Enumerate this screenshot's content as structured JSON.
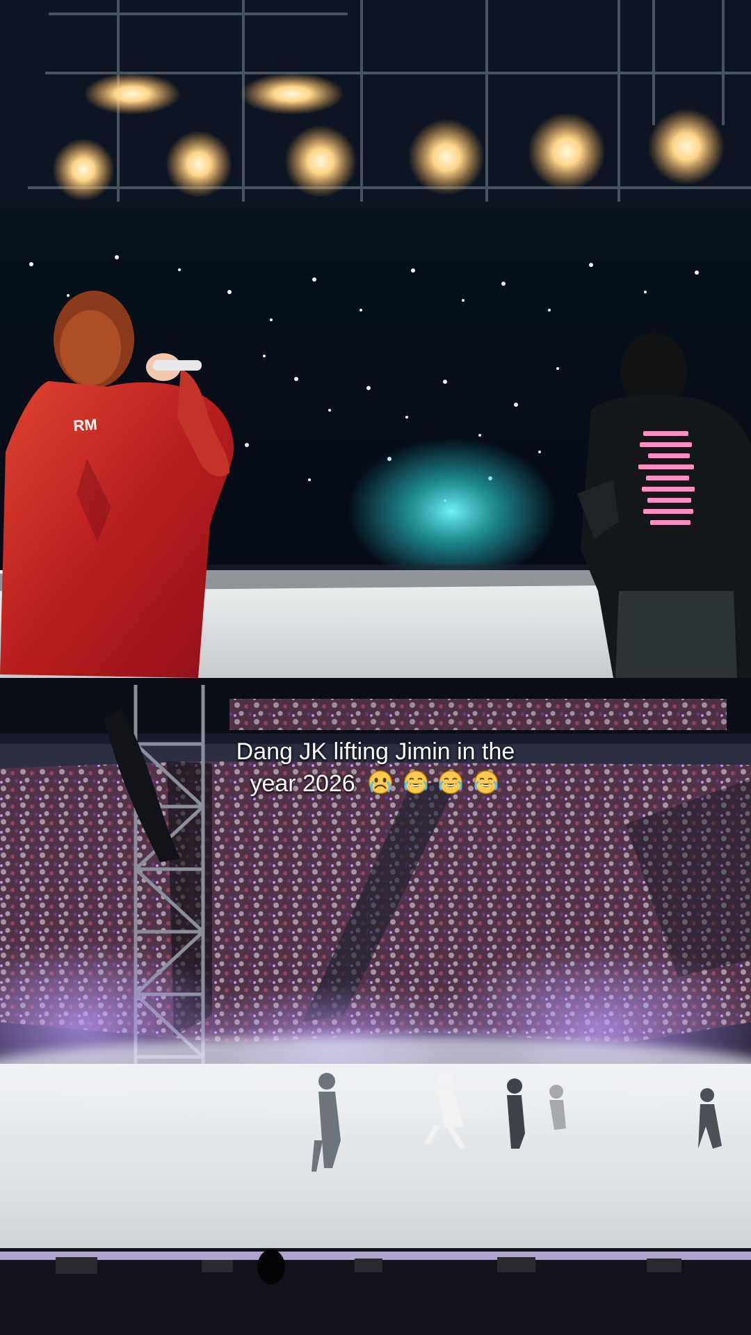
{
  "caption": {
    "line1": "Dang JK lifting Jimin in the",
    "line2": "year 2026"
  },
  "emojis": [
    {
      "icon": "crying-face-icon"
    },
    {
      "icon": "tears-of-joy-icon"
    },
    {
      "icon": "tears-of-joy-icon"
    },
    {
      "icon": "tears-of-joy-icon"
    }
  ],
  "colors": {
    "red_jersey": "#c7231f",
    "dark_shirt": "#111417",
    "stage_floor": "#d9dee1",
    "crowd": "#4a2a45",
    "fog": "#a990ff"
  }
}
